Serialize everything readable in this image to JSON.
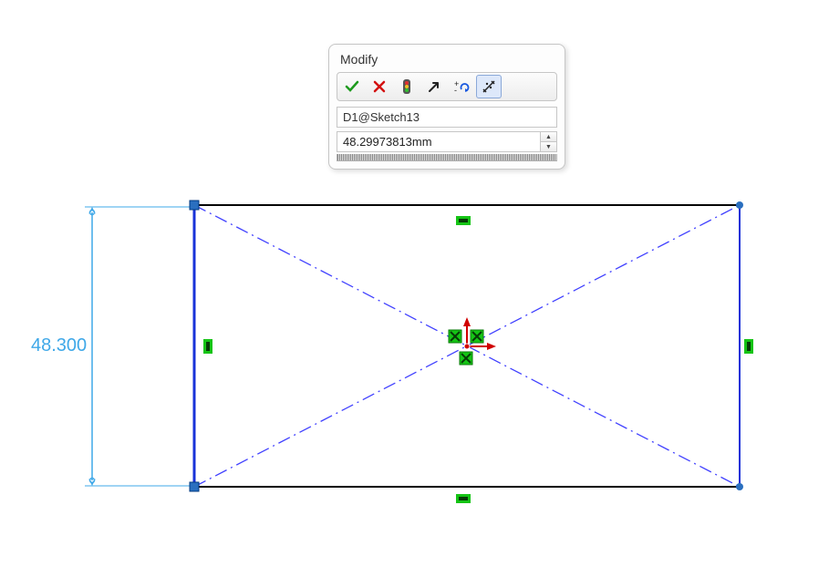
{
  "dialog": {
    "title": "Modify",
    "dimension_name": "D1@Sketch13",
    "dimension_value": "48.29973813mm"
  },
  "canvas": {
    "dimension_display": "48.300"
  }
}
